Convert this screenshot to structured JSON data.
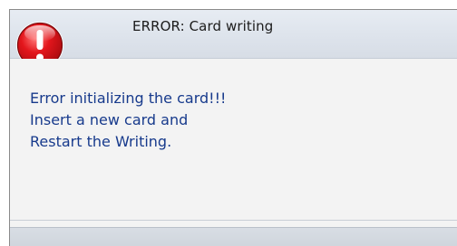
{
  "window": {
    "title": "ERROR: Card writing",
    "icon": "error-exclamation-icon"
  },
  "message": {
    "lines": [
      "Error initializing the card!!!",
      "Insert a new card and",
      "Restart the Writing."
    ]
  },
  "colors": {
    "icon_red": "#e3161c",
    "message_text": "#173a8c",
    "titlebar": "#dfe5ed"
  }
}
